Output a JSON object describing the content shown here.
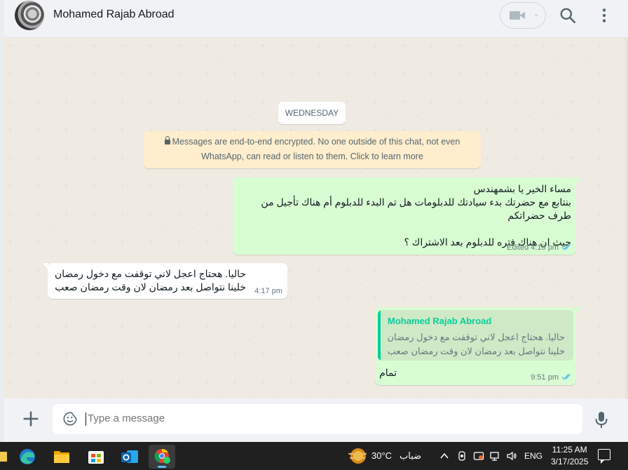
{
  "header": {
    "contact_name": "Mohamed Rajab Abroad",
    "icons": [
      "video-call-icon",
      "chevron-down-icon",
      "search-icon",
      "menu-icon"
    ]
  },
  "chat": {
    "date_separator": "WEDNESDAY",
    "encryption_notice": "Messages are end-to-end encrypted. No one outside of this chat, not even WhatsApp, can read or listen to them. Click to learn more",
    "messages": [
      {
        "direction": "outgoing",
        "text": "مساء الخير يا بشمهندس\nبنتابع مع حضرتك بدء سيادتك للدبلومات هل تم البدء للدبلوم أم هناك تأجيل من طرف حضراتكم\n\nحيث ان هناك فتره للدبلوم بعد الاشتراك ؟",
        "meta": "Edited 4:16 pm",
        "status": "delivered"
      },
      {
        "direction": "incoming",
        "text": "حاليا.  هحتاج اعجل لاني توقفت مع دخول رمضان\nخلينا نتواصل بعد رمضان لان وقت رمضان صعب",
        "meta": "4:17 pm"
      },
      {
        "direction": "outgoing",
        "quoted_author": "Mohamed Rajab Abroad",
        "quoted_text": "حاليا.  هحتاج اعجل لاني توقفت مع دخول رمضان\nخلينا نتواصل بعد رمضان لان وقت رمضان صعب",
        "text": "تمام",
        "meta": "9:51 pm",
        "status": "delivered"
      }
    ]
  },
  "composer": {
    "placeholder": "Type a message",
    "icons": [
      "plus-icon",
      "emoji-icon",
      "microphone-icon"
    ]
  },
  "taskbar": {
    "apps": [
      "edge-icon",
      "file-explorer-icon",
      "store-icon",
      "outlook-icon",
      "whatsapp-chrome-icon"
    ],
    "weather_temp": "30°C",
    "weather_condition": "ضباب",
    "language": "ENG",
    "time": "11:25 AM",
    "date": "3/17/2025"
  },
  "colors": {
    "outgoing_bubble": "#d9fdd3",
    "incoming_bubble": "#ffffff",
    "chat_background": "#efeae2",
    "accent_green": "#06cf9c",
    "tick_blue": "#53bdeb"
  }
}
